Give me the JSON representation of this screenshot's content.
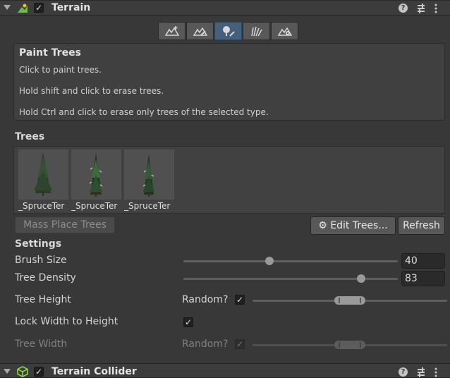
{
  "terrain_header": {
    "title": "Terrain",
    "enabled": true,
    "icons": [
      "terrain-icon",
      "help-icon",
      "presets-icon",
      "kebab-menu-icon"
    ]
  },
  "toolbar": {
    "tools": [
      {
        "name": "create-neighbor-terrains-tool"
      },
      {
        "name": "paint-terrain-tool"
      },
      {
        "name": "paint-trees-tool",
        "active": true
      },
      {
        "name": "paint-details-tool"
      },
      {
        "name": "terrain-settings-tool"
      }
    ]
  },
  "helpbox": {
    "title": "Paint Trees",
    "line1": "Click to paint trees.",
    "line2": "Hold shift and click to erase trees.",
    "line3": "Hold Ctrl and click to erase only trees of the selected type."
  },
  "trees": {
    "label": "Trees",
    "items": [
      {
        "caption": "_SpruceTer"
      },
      {
        "caption": "_SpruceTer"
      },
      {
        "caption": "_SpruceTer"
      }
    ]
  },
  "buttons": {
    "mass_place": "Mass Place Trees",
    "edit_trees": "Edit Trees...",
    "refresh": "Refresh"
  },
  "settings": {
    "label": "Settings",
    "brush_size_label": "Brush Size",
    "brush_size_value": "40",
    "brush_size_fraction": 0.4,
    "tree_density_label": "Tree Density",
    "tree_density_value": "83",
    "tree_density_fraction": 0.83,
    "tree_height_label": "Tree Height",
    "tree_height_random_label": "Random?",
    "tree_height_random": true,
    "lock_width_label": "Lock Width to Height",
    "lock_width": true,
    "tree_width_label": "Tree Width",
    "tree_width_random_label": "Random?",
    "tree_width_random": true
  },
  "collider_header": {
    "title": "Terrain Collider",
    "enabled": true
  }
}
